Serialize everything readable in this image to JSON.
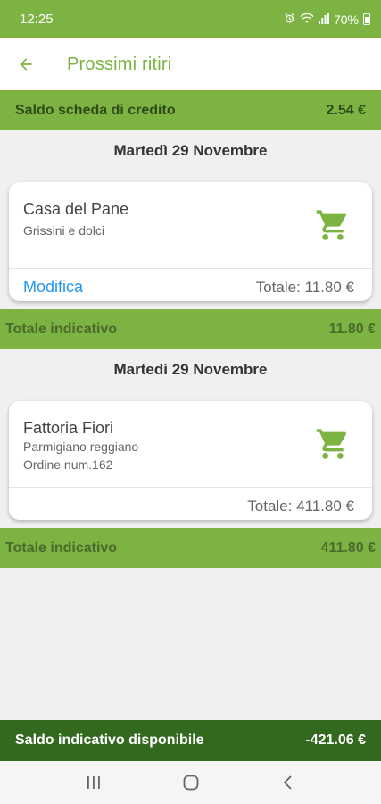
{
  "status_bar": {
    "time": "12:25",
    "battery": "70%",
    "icons": [
      "alarm-icon",
      "wifi-icon",
      "signal-icon",
      "battery-icon"
    ]
  },
  "app_bar": {
    "title": "Prossimi ritiri",
    "back_icon": "arrow-left-icon"
  },
  "credit": {
    "label": "Saldo scheda di credito",
    "value": "2.54 €"
  },
  "orders": [
    {
      "date": "Martedì 29 Novembre",
      "shop": "Casa del Pane",
      "lines": [
        "Grissini e dolci"
      ],
      "modify_label": "Modifica",
      "total": "Totale: 11.80 €",
      "indicative_label": "Totale indicativo",
      "indicative_value": "11.80 €"
    },
    {
      "date": "Martedì 29 Novembre",
      "shop": "Fattoria Fiori",
      "lines": [
        "Parmigiano reggiano",
        "Ordine num.162"
      ],
      "total": "Totale: 411.80 €",
      "indicative_label": "Totale indicativo",
      "indicative_value": "411.80 €"
    }
  ],
  "summary": {
    "label": "Saldo indicativo disponibile",
    "value": "-421.06 €"
  },
  "colors": {
    "primary": "#7cb342",
    "dark": "#33691e",
    "link": "#2196f3"
  },
  "nav": [
    "recent-apps-icon",
    "home-icon",
    "back-icon"
  ]
}
